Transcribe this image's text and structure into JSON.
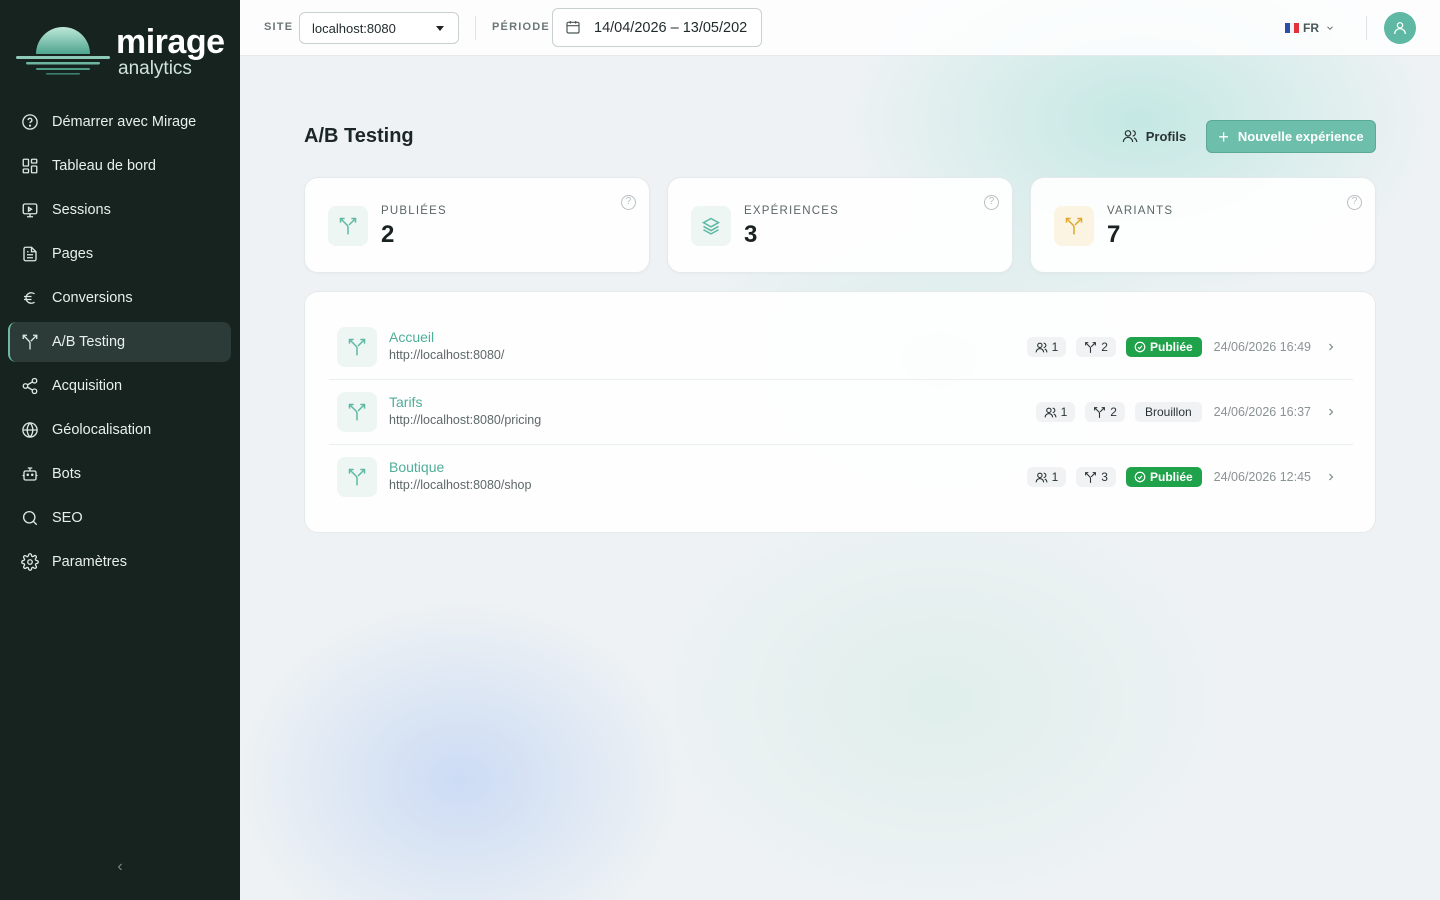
{
  "brand": {
    "name": "mirage",
    "sub": "analytics"
  },
  "sidebar": {
    "items": [
      {
        "label": "Démarrer avec Mirage",
        "icon": "help-circle-icon"
      },
      {
        "label": "Tableau de bord",
        "icon": "dashboard-icon"
      },
      {
        "label": "Sessions",
        "icon": "monitor-play-icon"
      },
      {
        "label": "Pages",
        "icon": "file-text-icon"
      },
      {
        "label": "Conversions",
        "icon": "euro-icon"
      },
      {
        "label": "A/B Testing",
        "icon": "split-icon",
        "active": true
      },
      {
        "label": "Acquisition",
        "icon": "share-icon"
      },
      {
        "label": "Géolocalisation",
        "icon": "globe-icon"
      },
      {
        "label": "Bots",
        "icon": "bot-icon"
      },
      {
        "label": "SEO",
        "icon": "search-icon"
      },
      {
        "label": "Paramètres",
        "icon": "gear-icon"
      }
    ],
    "collapse_icon": "chevron-left-icon"
  },
  "topbar": {
    "site_label": "SITE",
    "site_value": "localhost:8080",
    "period_label": "PÉRIODE",
    "period_value": "14/04/2026 – 13/05/202",
    "lang": "FR"
  },
  "page": {
    "title": "A/B Testing",
    "profils_label": "Profils",
    "new_label": "Nouvelle expérience"
  },
  "stats": [
    {
      "label": "PUBLIÉES",
      "value": "2",
      "icon": "split-icon",
      "color": "#5fb8a3",
      "bg": "#eef6f4"
    },
    {
      "label": "EXPÉRIENCES",
      "value": "3",
      "icon": "layers-icon",
      "color": "#5fb8a3",
      "bg": "#eef6f4"
    },
    {
      "label": "VARIANTS",
      "value": "7",
      "icon": "split-icon",
      "color": "#e0a92a",
      "bg": "#fbf4e2"
    }
  ],
  "experiments": [
    {
      "name": "Accueil",
      "url": "http://localhost:8080/",
      "profiles": "1",
      "variants": "2",
      "status": "Publiée",
      "date": "24/06/2026 16:49"
    },
    {
      "name": "Tarifs",
      "url": "http://localhost:8080/pricing",
      "profiles": "1",
      "variants": "2",
      "status": "Brouillon",
      "date": "24/06/2026 16:37"
    },
    {
      "name": "Boutique",
      "url": "http://localhost:8080/shop",
      "profiles": "1",
      "variants": "3",
      "status": "Publiée",
      "date": "24/06/2026 12:45"
    }
  ],
  "colors": {
    "sidebar_bg": "#16231f",
    "accent": "#6dbfab",
    "published": "#20a24a"
  }
}
